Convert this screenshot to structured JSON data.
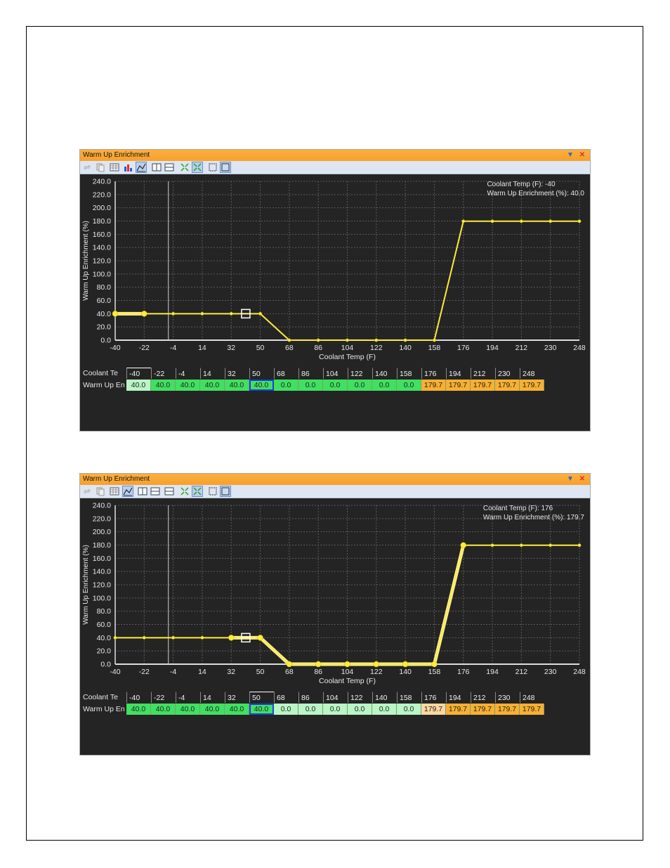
{
  "colors": {
    "curve": "#ffeb3b",
    "curve_highlight": "#fff09a",
    "grid": "#5a5a5a",
    "axis_text": "#e8e8e8",
    "cell_green_bright": "#40e060",
    "cell_green_light": "#90f0a8",
    "cell_green_pale": "#b9f5c6",
    "cell_orange": "#f8b030",
    "cell_orange_pale": "#fcd7a0"
  },
  "panels": [
    {
      "window_title": "Warm Up Enrichment",
      "readout": {
        "line1": "Coolant Temp (F): -40",
        "line2": "Warm Up Enrichment (%): 40.0"
      },
      "table": {
        "row1_label": "Coolant Te",
        "row2_label": "Warm Up En",
        "headers": [
          "-40",
          "-22",
          "-4",
          "14",
          "32",
          "50",
          "68",
          "86",
          "104",
          "122",
          "140",
          "158",
          "176",
          "194",
          "212",
          "230",
          "248"
        ],
        "values": [
          "40.0",
          "40.0",
          "40.0",
          "40.0",
          "40.0",
          "40.0",
          "0.0",
          "0.0",
          "0.0",
          "0.0",
          "0.0",
          "0.0",
          "179.7",
          "179.7",
          "179.7",
          "179.7",
          "179.7"
        ],
        "cell_colors": [
          "#b9f5c6",
          "#40e060",
          "#40e060",
          "#40e060",
          "#40e060",
          "#40e060",
          "#40e060",
          "#40e060",
          "#40e060",
          "#40e060",
          "#40e060",
          "#40e060",
          "#f8b030",
          "#f8b030",
          "#f8b030",
          "#f8b030",
          "#f8b030"
        ]
      },
      "chart_data": {
        "type": "line",
        "xlabel": "Coolant Temp (F)",
        "ylabel": "Warm Up Enrichment (%)",
        "x": [
          -40,
          -22,
          -4,
          14,
          32,
          50,
          68,
          86,
          104,
          122,
          140,
          158,
          176,
          194,
          212,
          230,
          248
        ],
        "series": [
          {
            "values": [
              40,
              40,
              40,
              40,
              40,
              40,
              0,
              0,
              0,
              0,
              0,
              0,
              179.7,
              179.7,
              179.7,
              179.7,
              179.7
            ]
          }
        ],
        "xlim": [
          -40,
          248
        ],
        "ylim": [
          0,
          240
        ],
        "xticks": [
          "-40",
          "-22",
          "-4",
          "14",
          "32",
          "50",
          "68",
          "86",
          "104",
          "122",
          "140",
          "158",
          "176",
          "194",
          "212",
          "230",
          "248"
        ],
        "yticks": [
          "0.0",
          "20.0",
          "40.0",
          "60.0",
          "80.0",
          "100.0",
          "120.0",
          "140.0",
          "160.0",
          "180.0",
          "200.0",
          "220.0",
          "240.0"
        ],
        "highlight_x": [
          -40,
          -22
        ],
        "grid": true
      }
    },
    {
      "window_title": "Warm Up Enrichment",
      "readout": {
        "line1": "Coolant Temp (F): 176",
        "line2": "Warm Up Enrichment (%): 179.7"
      },
      "table": {
        "row1_label": "Coolant Te",
        "row2_label": "Warm Up En",
        "headers": [
          "-40",
          "-22",
          "-4",
          "14",
          "32",
          "50",
          "68",
          "86",
          "104",
          "122",
          "140",
          "158",
          "176",
          "194",
          "212",
          "230",
          "248"
        ],
        "values": [
          "40.0",
          "40.0",
          "40.0",
          "40.0",
          "40.0",
          "40.0",
          "0.0",
          "0.0",
          "0.0",
          "0.0",
          "0.0",
          "0.0",
          "179.7",
          "179.7",
          "179.7",
          "179.7",
          "179.7"
        ],
        "cell_colors": [
          "#40e060",
          "#40e060",
          "#40e060",
          "#40e060",
          "#40e060",
          "#40e060",
          "#b9f5c6",
          "#b9f5c6",
          "#b9f5c6",
          "#b9f5c6",
          "#b9f5c6",
          "#b9f5c6",
          "#fcd7a0",
          "#f8b030",
          "#f8b030",
          "#f8b030",
          "#f8b030"
        ]
      },
      "chart_data": {
        "type": "line",
        "xlabel": "Coolant Temp (F)",
        "ylabel": "Warm Up Enrichment (%)",
        "x": [
          -40,
          -22,
          -4,
          14,
          32,
          50,
          68,
          86,
          104,
          122,
          140,
          158,
          176,
          194,
          212,
          230,
          248
        ],
        "series": [
          {
            "values": [
              40,
              40,
              40,
              40,
              40,
              40,
              0,
              0,
              0,
              0,
              0,
              0,
              179.7,
              179.7,
              179.7,
              179.7,
              179.7
            ]
          }
        ],
        "xlim": [
          -40,
          248
        ],
        "ylim": [
          0,
          240
        ],
        "xticks": [
          "-40",
          "-22",
          "-4",
          "14",
          "32",
          "50",
          "68",
          "86",
          "104",
          "122",
          "140",
          "158",
          "176",
          "194",
          "212",
          "230",
          "248"
        ],
        "yticks": [
          "0.0",
          "20.0",
          "40.0",
          "60.0",
          "80.0",
          "100.0",
          "120.0",
          "140.0",
          "160.0",
          "180.0",
          "200.0",
          "220.0",
          "240.0"
        ],
        "highlight_x": [
          32,
          50,
          68,
          86,
          104,
          122,
          140,
          158,
          176
        ],
        "grid": true
      }
    }
  ]
}
